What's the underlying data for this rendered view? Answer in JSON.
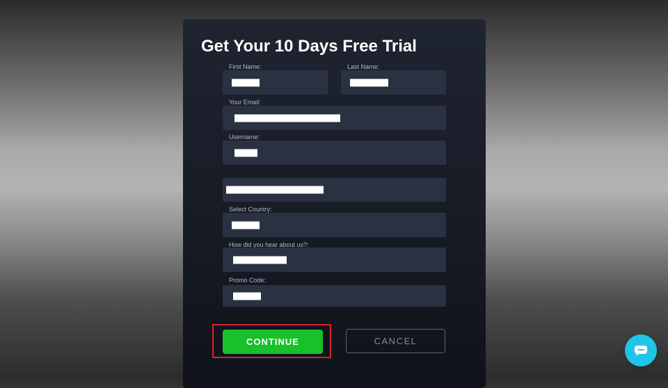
{
  "form": {
    "title": "Get Your 10 Days Free Trial",
    "first_name_label": "First Name:",
    "last_name_label": "Last Name:",
    "email_label": "Your Email:",
    "username_label": "Username:",
    "country_label": "Select Country:",
    "hear_label": "How did you hear about us?:",
    "promo_label": "Promo Code:"
  },
  "buttons": {
    "continue": "CONTINUE",
    "cancel": "CANCEL"
  },
  "colors": {
    "continue_green": "#18c12a",
    "highlight_red": "#d9232b",
    "chat_cyan": "#20c4e6",
    "field_bg": "#2a3142"
  },
  "icons": {
    "chat": "chat-bubble-icon"
  }
}
